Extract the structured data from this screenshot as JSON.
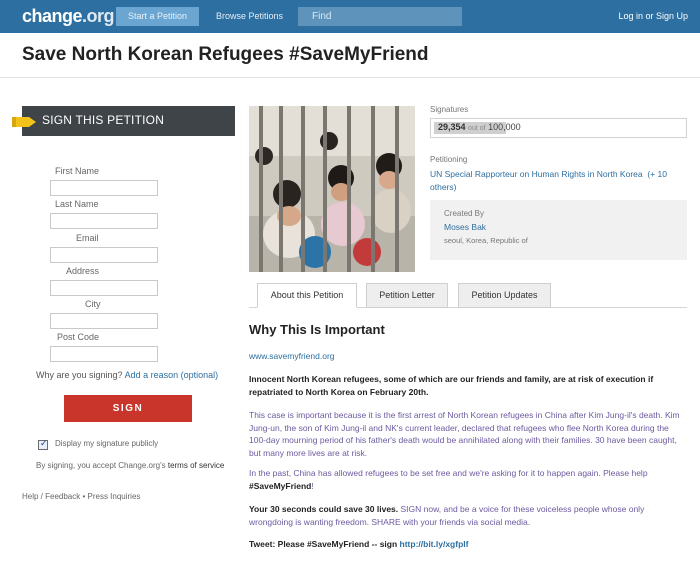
{
  "header": {
    "logo_text": "change",
    "logo_tld": ".org",
    "nav_start": "Start a Petition",
    "nav_browse": "Browse Petitions",
    "search_placeholder": "Find",
    "login": "Log in or Sign Up"
  },
  "petition": {
    "title": "Save North Korean Refugees #SaveMyFriend"
  },
  "sign_panel": {
    "banner": "SIGN THIS PETITION",
    "fields": {
      "first_name": "First Name",
      "last_name": "Last Name",
      "email": "Email",
      "address": "Address",
      "city": "City",
      "post_code": "Post Code"
    },
    "why_question": "Why are you signing?",
    "add_reason": "Add a reason (optional)",
    "sign_button": "SIGN",
    "display_publicly": "Display my signature publicly",
    "display_checked": true,
    "terms_prefix": "By signing, you accept Change.org's",
    "terms_link": "terms of service",
    "footer": "Help / Feedback • Press Inquiries"
  },
  "stats": {
    "signatures_label": "Signatures",
    "count": "29,354",
    "out_of": "out of",
    "goal": "100,000",
    "progress_fraction": 0.29,
    "petitioning_label": "Petitioning",
    "target": "UN Special Rapporteur on Human Rights in North Korea",
    "more_targets": "(+ 10 others)",
    "created_by_label": "Created By",
    "creator": "Moses Bak",
    "location": "seoul, Korea, Republic of"
  },
  "tabs": [
    "About this Petition",
    "Petition Letter",
    "Petition Updates"
  ],
  "content": {
    "heading": "Why This Is Important",
    "link": "www.savemyfriend.org",
    "p1": "Innocent North Korean refugees, some of which are our friends and family, are at risk of execution if repatriated to North Korea on February 20th.",
    "p2": "This case is important because it is the first arrest of North Korean refugees in China after Kim Jung-il's death. Kim Jung-un, the son of Kim Jung-il and NK's current leader, declared that refugees who flee North Korea during the 100-day mourning period of his father's death would be annihilated along with their families.   30 have been caught, but many more lives are at risk.",
    "p3_a": "In the past, China has allowed refugees to be set free and we're asking for it to happen again. Please help",
    "p3_b": "#SaveMyFriend",
    "p3_c": "!",
    "p4_bold": "Your 30 seconds could save 30 lives.",
    "p4_rest": " SIGN now, and be a voice for these voiceless people whose only wrongdoing is wanting freedom. SHARE with your friends via social media.",
    "tweet_prefix": "Tweet: Please #SaveMyFriend -- sign ",
    "tweet_link": "http://bit.ly/xgfplf"
  },
  "colors": {
    "header_bg": "#2d6fa0",
    "sign_button": "#c9352b",
    "link": "#2d6fa0",
    "banner_dark": "#3f4448",
    "flag_yellow": "#f3c21b"
  }
}
